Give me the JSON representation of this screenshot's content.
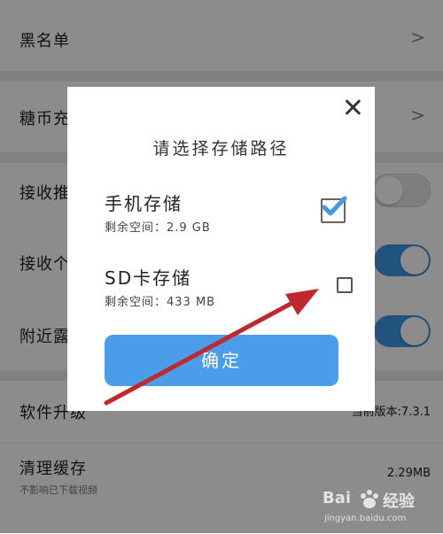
{
  "settings": {
    "blacklist": {
      "label": "黑名单",
      "chevron": ">"
    },
    "candy": {
      "label": "糖币充",
      "chevron": ">"
    },
    "push1": {
      "label": "接收推",
      "toggle": "off"
    },
    "push2": {
      "label": "接收个",
      "toggle": "on"
    },
    "nearby": {
      "label": "附近露",
      "toggle": "on"
    },
    "update": {
      "label": "软件升级",
      "value": "当前版本:7.3.1"
    },
    "cache": {
      "label": "清理缓存",
      "subtitle": "不影响已下载视频",
      "value": "2.29MB"
    }
  },
  "dialog": {
    "close_glyph": "✕",
    "title": "请选择存储路径",
    "options": [
      {
        "title": "手机存储",
        "space": "剩余空间：2.9 GB",
        "checked": true
      },
      {
        "title": "SD卡存储",
        "space": "剩余空间：433 MB",
        "checked": false
      }
    ],
    "confirm": "确定"
  },
  "watermark": {
    "brand": "Bai",
    "brand2": "经验",
    "url": "jingyan.baidu.com"
  },
  "colors": {
    "accent": "#4a9de8",
    "toggle_on": "#3f98e8",
    "arrow": "#c0282e"
  }
}
